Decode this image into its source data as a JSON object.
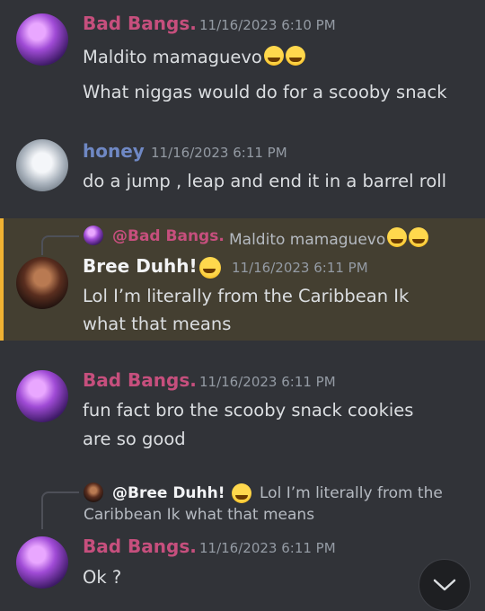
{
  "messages": [
    {
      "author": "Bad Bangs.",
      "time": "11/16/2023 6:10 PM",
      "lines": [
        "Maldito mamaguevo",
        "What niggas would do for a scooby snack"
      ]
    },
    {
      "author": "honey",
      "time": "11/16/2023 6:11 PM",
      "lines": [
        "do a jump , leap and end it in a barrel roll"
      ]
    },
    {
      "reply": {
        "author": "@Bad Bangs.",
        "text": "Maldito mamaguevo"
      },
      "author": "Bree Duhh!",
      "time": "11/16/2023 6:11 PM",
      "lines": [
        "Lol I’m literally from the Caribbean Ik",
        "what that means"
      ]
    },
    {
      "author": "Bad Bangs.",
      "time": "11/16/2023 6:11 PM",
      "lines": [
        "fun fact bro the scooby snack cookies",
        "are so good"
      ]
    },
    {
      "reply": {
        "author": "@Bree Duhh!",
        "text": "Lol I’m literally from the",
        "text2": "Caribbean Ik what that means"
      },
      "author": "Bad Bangs.",
      "time": "11/16/2023 6:11 PM",
      "lines": [
        "Ok ?"
      ]
    }
  ],
  "icons": {
    "emoji_crying": "loudly-crying-face-emoji",
    "emoji_thinking": "shushing-face-emoji",
    "scroll": "chevron-down-icon"
  },
  "colors": {
    "background": "#313338",
    "highlight": "#443f31",
    "mention_bar": "#f0b232",
    "name_pink": "#c64f7d",
    "name_blue": "#6f88c4"
  }
}
